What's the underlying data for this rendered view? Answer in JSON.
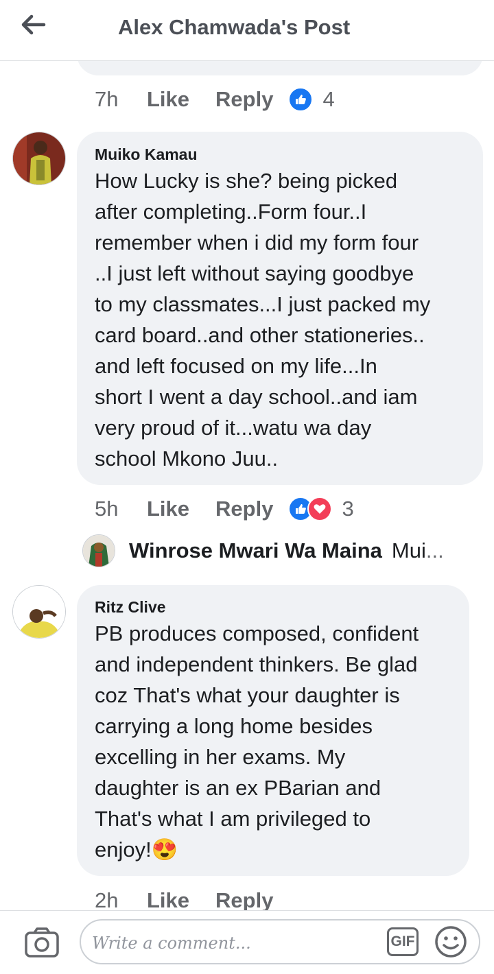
{
  "header": {
    "title": "Alex Chamwada's Post"
  },
  "comments": [
    {
      "time": "7h",
      "like_label": "Like",
      "reply_label": "Reply",
      "reaction_count": "4"
    },
    {
      "author": "Muiko Kamau",
      "text": "How Lucky is she? being picked\nafter completing..Form four..I\nremember when i did my form four\n..I just left without saying goodbye\nto my classmates...I just packed my\ncard board..and other stationeries..\nand left focused on my life...In\nshort I went a day school..and iam\nvery proud of it...watu wa day\nschool Mkono Juu..",
      "time": "5h",
      "like_label": "Like",
      "reply_label": "Reply",
      "reaction_count": "3",
      "reply_preview": {
        "name": "Winrose Mwari Wa Maina",
        "snippet": "Mui",
        "ellipsis": "..."
      }
    },
    {
      "author": "Ritz Clive",
      "text": "PB produces composed, confident\nand independent thinkers. Be glad\ncoz That's what your daughter is\ncarrying a long home besides\nexcelling in her exams. My\ndaughter is an ex PBarian and\nThat's what I am privileged to\nenjoy!",
      "emoji": "😍",
      "time": "2h",
      "like_label": "Like",
      "reply_label": "Reply"
    }
  ],
  "footer": {
    "placeholder": "Write a comment...",
    "gif_label": "GIF"
  },
  "colors": {
    "accent": "#1877f2",
    "love": "#f33e58",
    "bubble": "#f0f2f5",
    "meta": "#65676b"
  }
}
